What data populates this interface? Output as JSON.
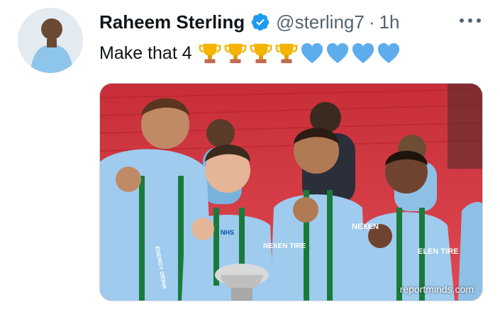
{
  "tweet": {
    "display_name": "Raheem Sterling",
    "handle": "@sterling7",
    "separator": "·",
    "time": "1h",
    "text": "Make that 4",
    "emojis": [
      "trophy-icon",
      "trophy-icon",
      "trophy-icon",
      "trophy-icon",
      "blue-heart-icon",
      "blue-heart-icon",
      "blue-heart-icon",
      "blue-heart-icon"
    ],
    "verified": true
  },
  "media": {
    "watermark": "reportminds.com",
    "image_text": [
      "NEXEN TIRE",
      "NHS",
      "ENERGY DRINK",
      "NEXEN",
      "ELEN TIRE"
    ]
  },
  "colors": {
    "verified_blue": "#1d9bf0",
    "handle_grey": "#536471",
    "trophy_gold": "#f4b400",
    "heart_blue": "#5dadec",
    "kit_sky_blue": "#9ecbee",
    "stadium_red": "#d23a43"
  }
}
